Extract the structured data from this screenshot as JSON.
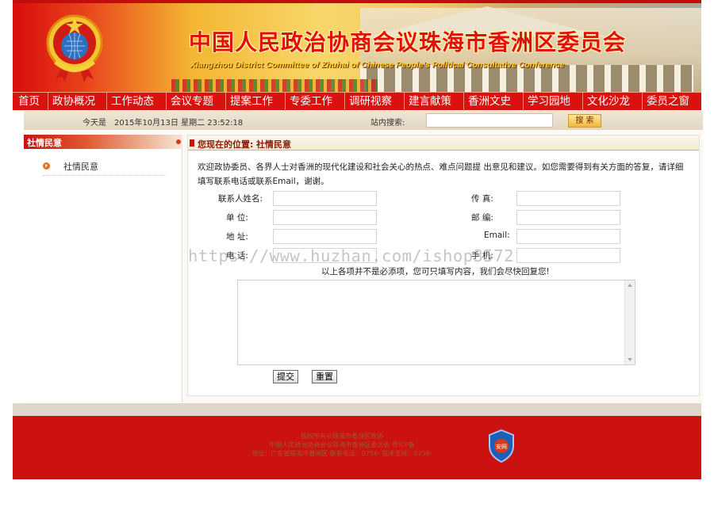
{
  "banner": {
    "title": "中国人民政治协商会议珠海市香洲区委员会",
    "subtitle": "Xiangzhou District Committee of Zhuhai of Chinese People's Political Consultative Conference"
  },
  "nav": {
    "items": [
      {
        "label": "首页"
      },
      {
        "label": "政协概况"
      },
      {
        "label": "工作动态"
      },
      {
        "label": "会议专题"
      },
      {
        "label": "提案工作"
      },
      {
        "label": "专委工作"
      },
      {
        "label": "调研视察"
      },
      {
        "label": "建言献策"
      },
      {
        "label": "香洲文史"
      },
      {
        "label": "学习园地"
      },
      {
        "label": "文化沙龙"
      },
      {
        "label": "委员之窗"
      }
    ]
  },
  "infobar": {
    "date_label": "今天是",
    "date_value": "2015年10月13日 星期二  23:52:18",
    "search_label": "站内搜索:",
    "search_value": "",
    "search_button": "搜 索"
  },
  "sidebar": {
    "title": "社情民意",
    "items": [
      {
        "label": "社情民意"
      }
    ]
  },
  "main": {
    "crumb_prefix": "您现在的位置:",
    "crumb_current": "社情民意",
    "intro": "欢迎政协委员、各界人士对香洲的现代化建设和社会关心的热点、难点问题提 出意见和建议。如您需要得到有关方面的答复，请详细填写联系电话或联系Email，谢谢。",
    "form": {
      "name_label": "联系人姓名:",
      "fax_label": "传    真:",
      "unit_label": "单    位:",
      "postcode_label": "邮    编:",
      "address_label": "地    址:",
      "email_label": "Email:",
      "phone_label": "电    话:",
      "mobile_label": "手    机:",
      "hint": "以上各项并不是必添项，您可只填写内容，我们会尽快回复您!",
      "submit": "提交",
      "reset": "重置"
    }
  },
  "footer": {
    "line1": "版权所有©珠海市香洲区政协",
    "line2": "中国人民政治协商会议珠海市香洲区委员会 粤ICP备",
    "line3": "地址：广东省珠海市香洲区 联系电话：0756- 技术支持：0756-"
  },
  "watermark": "https://www.huzhan.com/ishop3572",
  "colors": {
    "nav_red": "#d9110f",
    "footer_red": "#cc1111",
    "crumb_text": "#8a1a0a"
  },
  "icons": {
    "emblem": "cppcc-emblem-icon",
    "bullet": "orange-arrow-bullet-icon",
    "badge": "security-shield-icon"
  }
}
